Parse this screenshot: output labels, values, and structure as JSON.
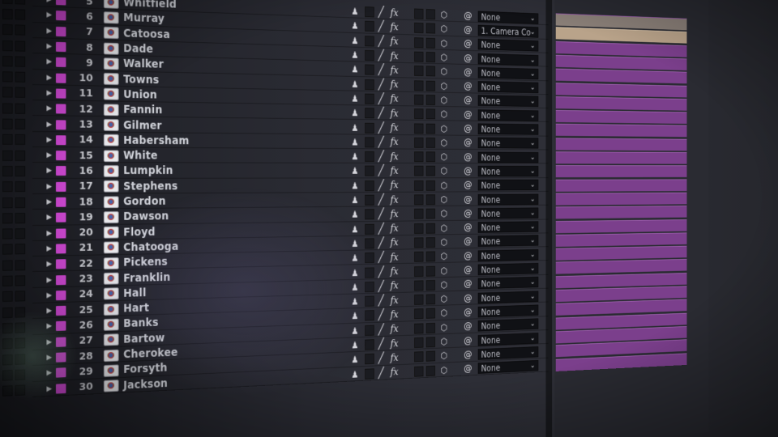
{
  "layers": [
    {
      "num": "5",
      "name": "Whitfield",
      "label_color": "#d34ad7",
      "parent": "None"
    },
    {
      "num": "6",
      "name": "Murray",
      "label_color": "#d34ad7",
      "parent": "1. Camera Co"
    },
    {
      "num": "7",
      "name": "Catoosa",
      "label_color": "#d34ad7",
      "parent": "None"
    },
    {
      "num": "8",
      "name": "Dade",
      "label_color": "#d34ad7",
      "parent": "None"
    },
    {
      "num": "9",
      "name": "Walker",
      "label_color": "#d34ad7",
      "parent": "None"
    },
    {
      "num": "10",
      "name": "Towns",
      "label_color": "#d34ad7",
      "parent": "None"
    },
    {
      "num": "11",
      "name": "Union",
      "label_color": "#d34ad7",
      "parent": "None"
    },
    {
      "num": "12",
      "name": "Fannin",
      "label_color": "#d34ad7",
      "parent": "None"
    },
    {
      "num": "13",
      "name": "Gilmer",
      "label_color": "#d34ad7",
      "parent": "None"
    },
    {
      "num": "14",
      "name": "Habersham",
      "label_color": "#d34ad7",
      "parent": "None"
    },
    {
      "num": "15",
      "name": "White",
      "label_color": "#d34ad7",
      "parent": "None"
    },
    {
      "num": "16",
      "name": "Lumpkin",
      "label_color": "#d34ad7",
      "parent": "None"
    },
    {
      "num": "17",
      "name": "Stephens",
      "label_color": "#d34ad7",
      "parent": "None"
    },
    {
      "num": "18",
      "name": "Gordon",
      "label_color": "#d34ad7",
      "parent": "None"
    },
    {
      "num": "19",
      "name": "Dawson",
      "label_color": "#d34ad7",
      "parent": "None"
    },
    {
      "num": "20",
      "name": "Floyd",
      "label_color": "#d34ad7",
      "parent": "None"
    },
    {
      "num": "21",
      "name": "Chatooga",
      "label_color": "#d34ad7",
      "parent": "None"
    },
    {
      "num": "22",
      "name": "Pickens",
      "label_color": "#d34ad7",
      "parent": "None"
    },
    {
      "num": "23",
      "name": "Franklin",
      "label_color": "#d34ad7",
      "parent": "None"
    },
    {
      "num": "24",
      "name": "Hall",
      "label_color": "#d34ad7",
      "parent": "None"
    },
    {
      "num": "25",
      "name": "Hart",
      "label_color": "#d34ad7",
      "parent": "None"
    },
    {
      "num": "26",
      "name": "Banks",
      "label_color": "#d34ad7",
      "parent": "None"
    },
    {
      "num": "27",
      "name": "Bartow",
      "label_color": "#d34ad7",
      "parent": "None"
    },
    {
      "num": "28",
      "name": "Cherokee",
      "label_color": "#d34ad7",
      "parent": "None"
    },
    {
      "num": "29",
      "name": "Forsyth",
      "label_color": "#d34ad7",
      "parent": "None"
    },
    {
      "num": "30",
      "name": "Jackson",
      "label_color": "#d34ad7",
      "parent": "None"
    }
  ],
  "icons": {
    "shy": "puppet-pin-icon",
    "quality": "slash-quality-icon",
    "effects": "fx-icon",
    "threed": "3d-cube-icon",
    "motion": "spiral-icon"
  },
  "glyphs": {
    "shy": "♟",
    "quality": "╱",
    "effects": "fx",
    "threed": "⬡",
    "motion": "@",
    "twirl": "▶",
    "chevron": "⌄"
  },
  "colors": {
    "track_bar": "#7b3f8c",
    "camera_bar": "#b9a38a"
  }
}
